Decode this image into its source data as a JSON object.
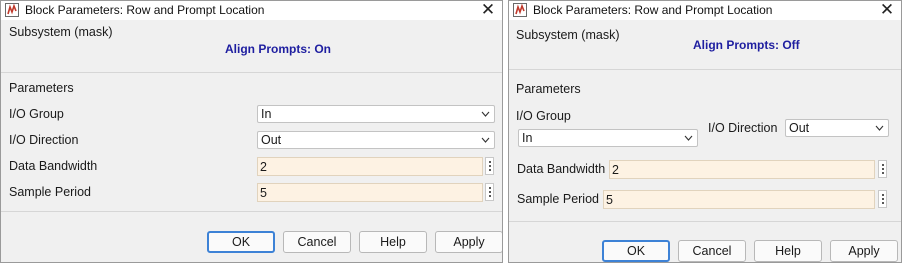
{
  "dialogs": {
    "left": {
      "title": "Block Parameters: Row and Prompt Location",
      "subsystem_label": "Subsystem (mask)",
      "align_status": "Align Prompts: On",
      "parameters_label": "Parameters",
      "io_group": {
        "label": "I/O Group",
        "value": "In"
      },
      "io_direction": {
        "label": "I/O Direction",
        "value": "Out"
      },
      "data_bandwidth": {
        "label": "Data Bandwidth",
        "value": "2"
      },
      "sample_period": {
        "label": "Sample Period",
        "value": "5"
      },
      "buttons": {
        "ok": "OK",
        "cancel": "Cancel",
        "help": "Help",
        "apply": "Apply"
      }
    },
    "right": {
      "title": "Block Parameters: Row and Prompt Location",
      "subsystem_label": "Subsystem (mask)",
      "align_status": "Align Prompts: Off",
      "parameters_label": "Parameters",
      "io_group": {
        "label": "I/O Group",
        "value": "In"
      },
      "io_direction": {
        "label": "I/O Direction",
        "value": "Out"
      },
      "data_bandwidth": {
        "label": "Data Bandwidth",
        "value": "2"
      },
      "sample_period": {
        "label": "Sample Period",
        "value": "5"
      },
      "buttons": {
        "ok": "OK",
        "cancel": "Cancel",
        "help": "Help",
        "apply": "Apply"
      }
    }
  },
  "colors": {
    "align_status_text": "#1e1ea0",
    "editable_field_bg": "#fdf2e3",
    "default_button_border": "#3d82d6",
    "dialog_bg": "#f0f0f0"
  },
  "icons": {
    "app_icon": "simulink-block-icon",
    "close": "close-icon",
    "dropdown": "chevron-down-icon",
    "field_menu": "kebab-menu-icon"
  }
}
